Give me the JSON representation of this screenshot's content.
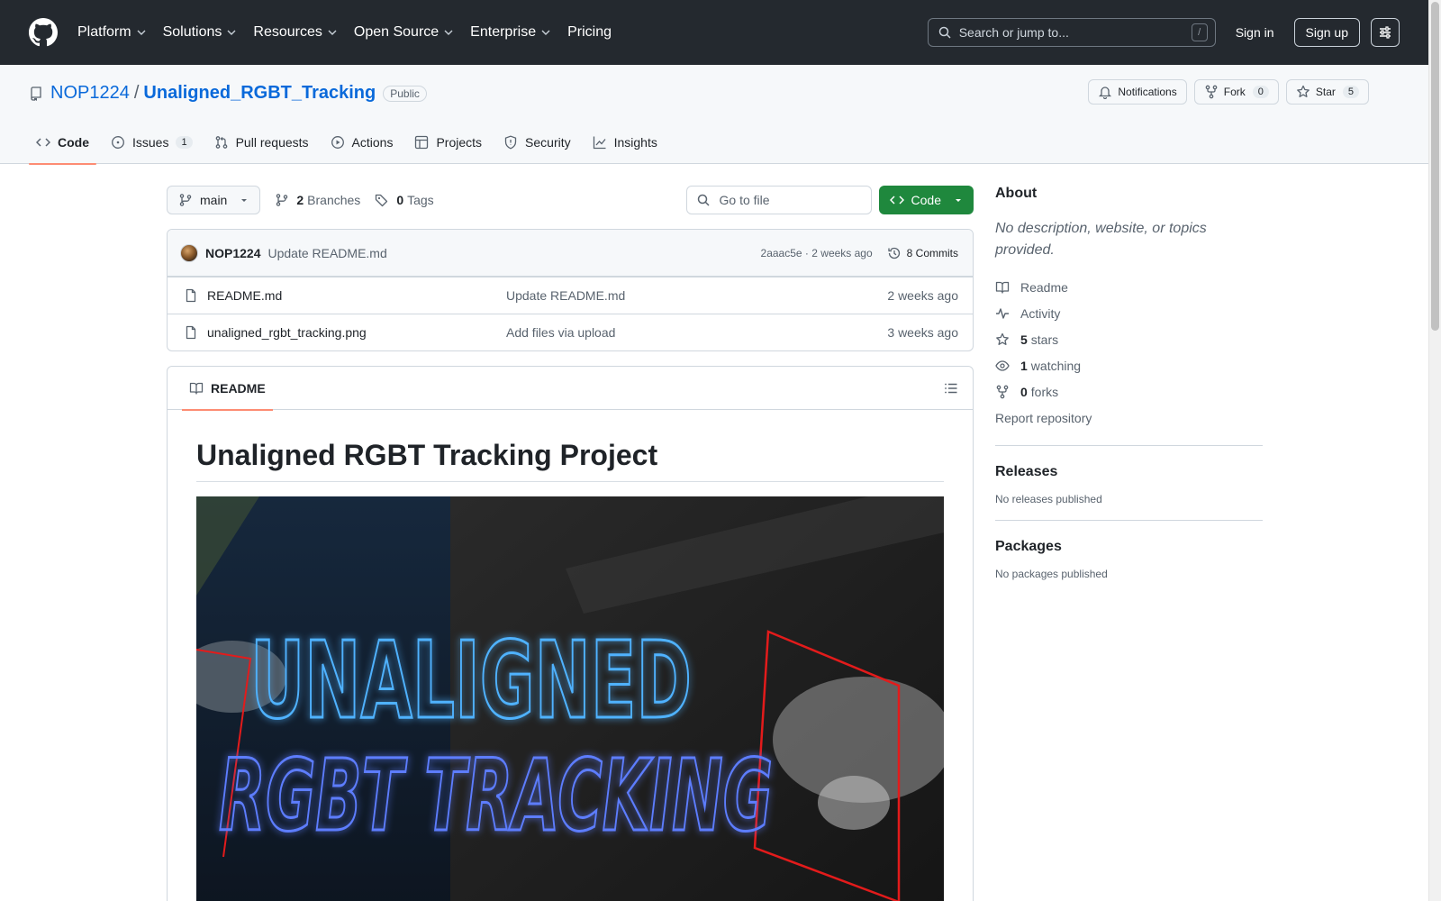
{
  "header": {
    "nav": [
      {
        "label": "Platform",
        "has_menu": true
      },
      {
        "label": "Solutions",
        "has_menu": true
      },
      {
        "label": "Resources",
        "has_menu": true
      },
      {
        "label": "Open Source",
        "has_menu": true
      },
      {
        "label": "Enterprise",
        "has_menu": true
      },
      {
        "label": "Pricing",
        "has_menu": false
      }
    ],
    "search_placeholder": "Search or jump to...",
    "search_shortcut": "/",
    "signin": "Sign in",
    "signup": "Sign up"
  },
  "repo": {
    "owner": "NOP1224",
    "separator": "/",
    "name": "Unaligned_RGBT_Tracking",
    "visibility": "Public",
    "notifications_label": "Notifications",
    "fork_label": "Fork",
    "fork_count": "0",
    "star_label": "Star",
    "star_count": "5"
  },
  "tabs": [
    {
      "label": "Code",
      "icon": "code-icon",
      "active": true,
      "count": ""
    },
    {
      "label": "Issues",
      "icon": "issue-opened-icon",
      "active": false,
      "count": "1"
    },
    {
      "label": "Pull requests",
      "icon": "git-pull-request-icon",
      "active": false,
      "count": ""
    },
    {
      "label": "Actions",
      "icon": "play-icon",
      "active": false,
      "count": ""
    },
    {
      "label": "Projects",
      "icon": "table-icon",
      "active": false,
      "count": ""
    },
    {
      "label": "Security",
      "icon": "shield-icon",
      "active": false,
      "count": ""
    },
    {
      "label": "Insights",
      "icon": "graph-icon",
      "active": false,
      "count": ""
    }
  ],
  "toolbar": {
    "branch": "main",
    "branches_count": "2",
    "branches_label": "Branches",
    "tags_count": "0",
    "tags_label": "Tags",
    "goto_placeholder": "Go to file",
    "code_button": "Code"
  },
  "latest_commit": {
    "author": "NOP1224",
    "message": "Update README.md",
    "sha": "2aaac5e",
    "dot": "·",
    "time": "2 weeks ago",
    "commits_label": "8 Commits"
  },
  "files": [
    {
      "name": "README.md",
      "message": "Update README.md",
      "time": "2 weeks ago"
    },
    {
      "name": "unaligned_rgbt_tracking.png",
      "message": "Add files via upload",
      "time": "3 weeks ago"
    }
  ],
  "readme": {
    "tab_label": "README",
    "heading": "Unaligned RGBT Tracking Project",
    "banner_line1": "UNALIGNED",
    "banner_line2": "RGBT TRACKING"
  },
  "about": {
    "title": "About",
    "description": "No description, website, or topics provided.",
    "readme": "Readme",
    "activity": "Activity",
    "stars_count": "5",
    "stars_label": "stars",
    "watching_count": "1",
    "watching_label": "watching",
    "forks_count": "0",
    "forks_label": "forks",
    "report": "Report repository"
  },
  "releases": {
    "title": "Releases",
    "empty": "No releases published"
  },
  "packages": {
    "title": "Packages",
    "empty": "No packages published"
  },
  "colors": {
    "header_bg": "#24292f",
    "link": "#0969da",
    "primary_button": "#1f883d",
    "tab_underline": "#fd8c73",
    "neon_blue": "#3fa9ff",
    "neon_purple": "#8a6cff"
  }
}
